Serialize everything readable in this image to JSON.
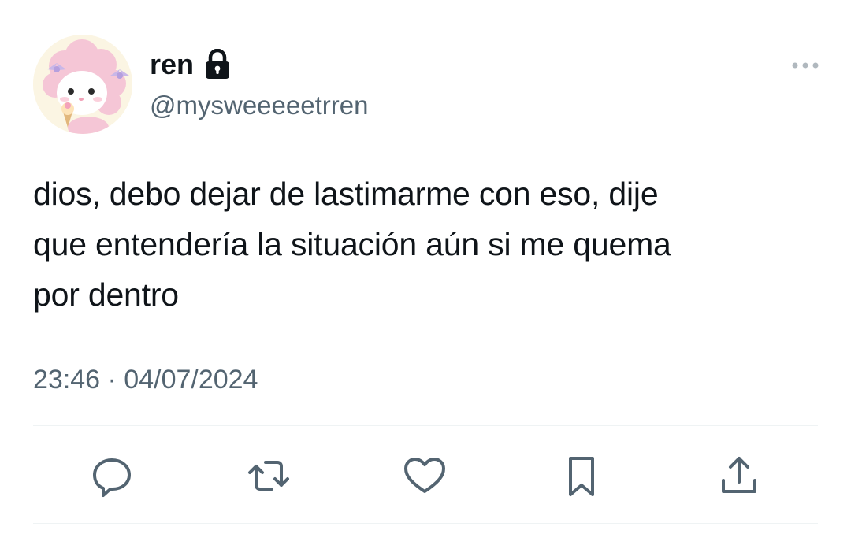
{
  "user": {
    "display_name": "ren",
    "handle": "@mysweeeeetrren",
    "protected_icon": "lock-icon",
    "avatar_icon": "avatar-image"
  },
  "tweet": {
    "text": "dios, debo dejar de lastimarme con eso, dije\nque entendería la situación aún si me quema\npor dentro",
    "timestamp": "23:46 · 04/07/2024"
  },
  "menu": {
    "icon": "more-horizontal-icon"
  },
  "actions": [
    {
      "name": "reply",
      "icon": "reply-icon"
    },
    {
      "name": "retweet",
      "icon": "retweet-icon"
    },
    {
      "name": "like",
      "icon": "like-icon"
    },
    {
      "name": "bookmark",
      "icon": "bookmark-icon"
    },
    {
      "name": "share",
      "icon": "share-icon"
    }
  ],
  "colors": {
    "text_primary": "#0f1419",
    "text_secondary": "#536471",
    "icon": "#536471",
    "divider": "#eff3f4"
  }
}
